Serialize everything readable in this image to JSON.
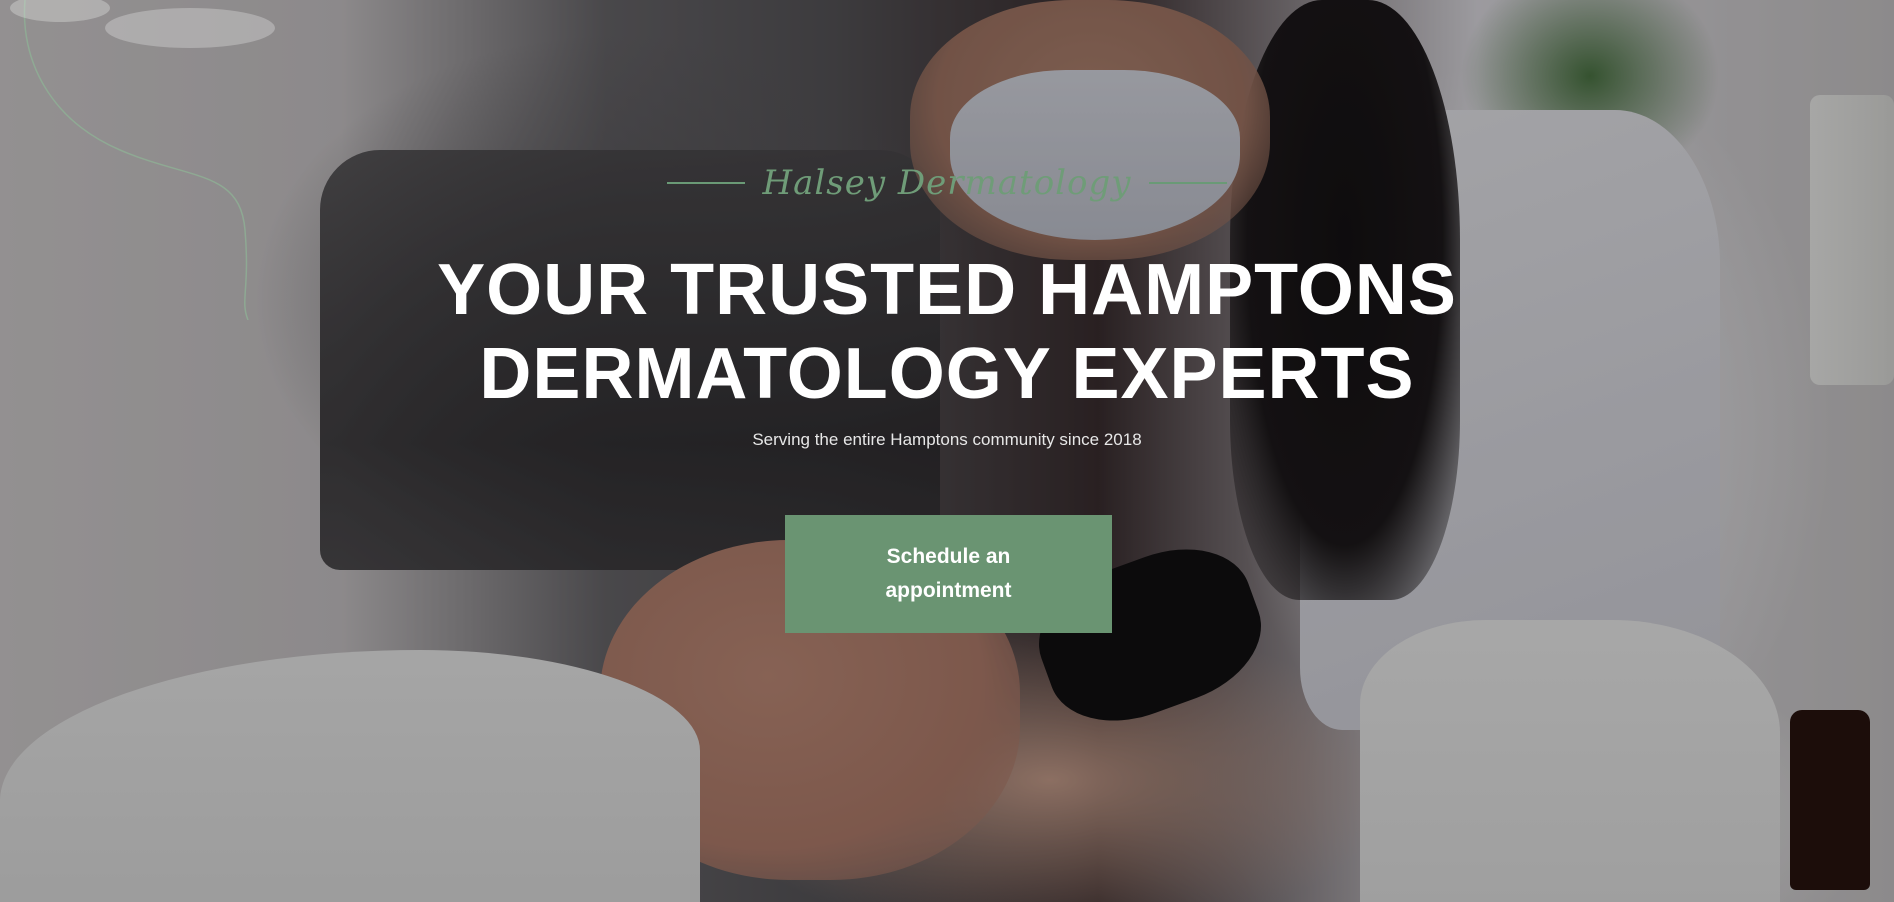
{
  "brand": {
    "name": "Halsey Dermatology",
    "accent_color": "#6a9472"
  },
  "hero": {
    "headline_line1": "YOUR TRUSTED HAMPTONS",
    "headline_line2": "DERMATOLOGY EXPERTS",
    "subtitle": "Serving the entire Hamptons community since 2018",
    "cta_label": "Schedule an appointment"
  }
}
